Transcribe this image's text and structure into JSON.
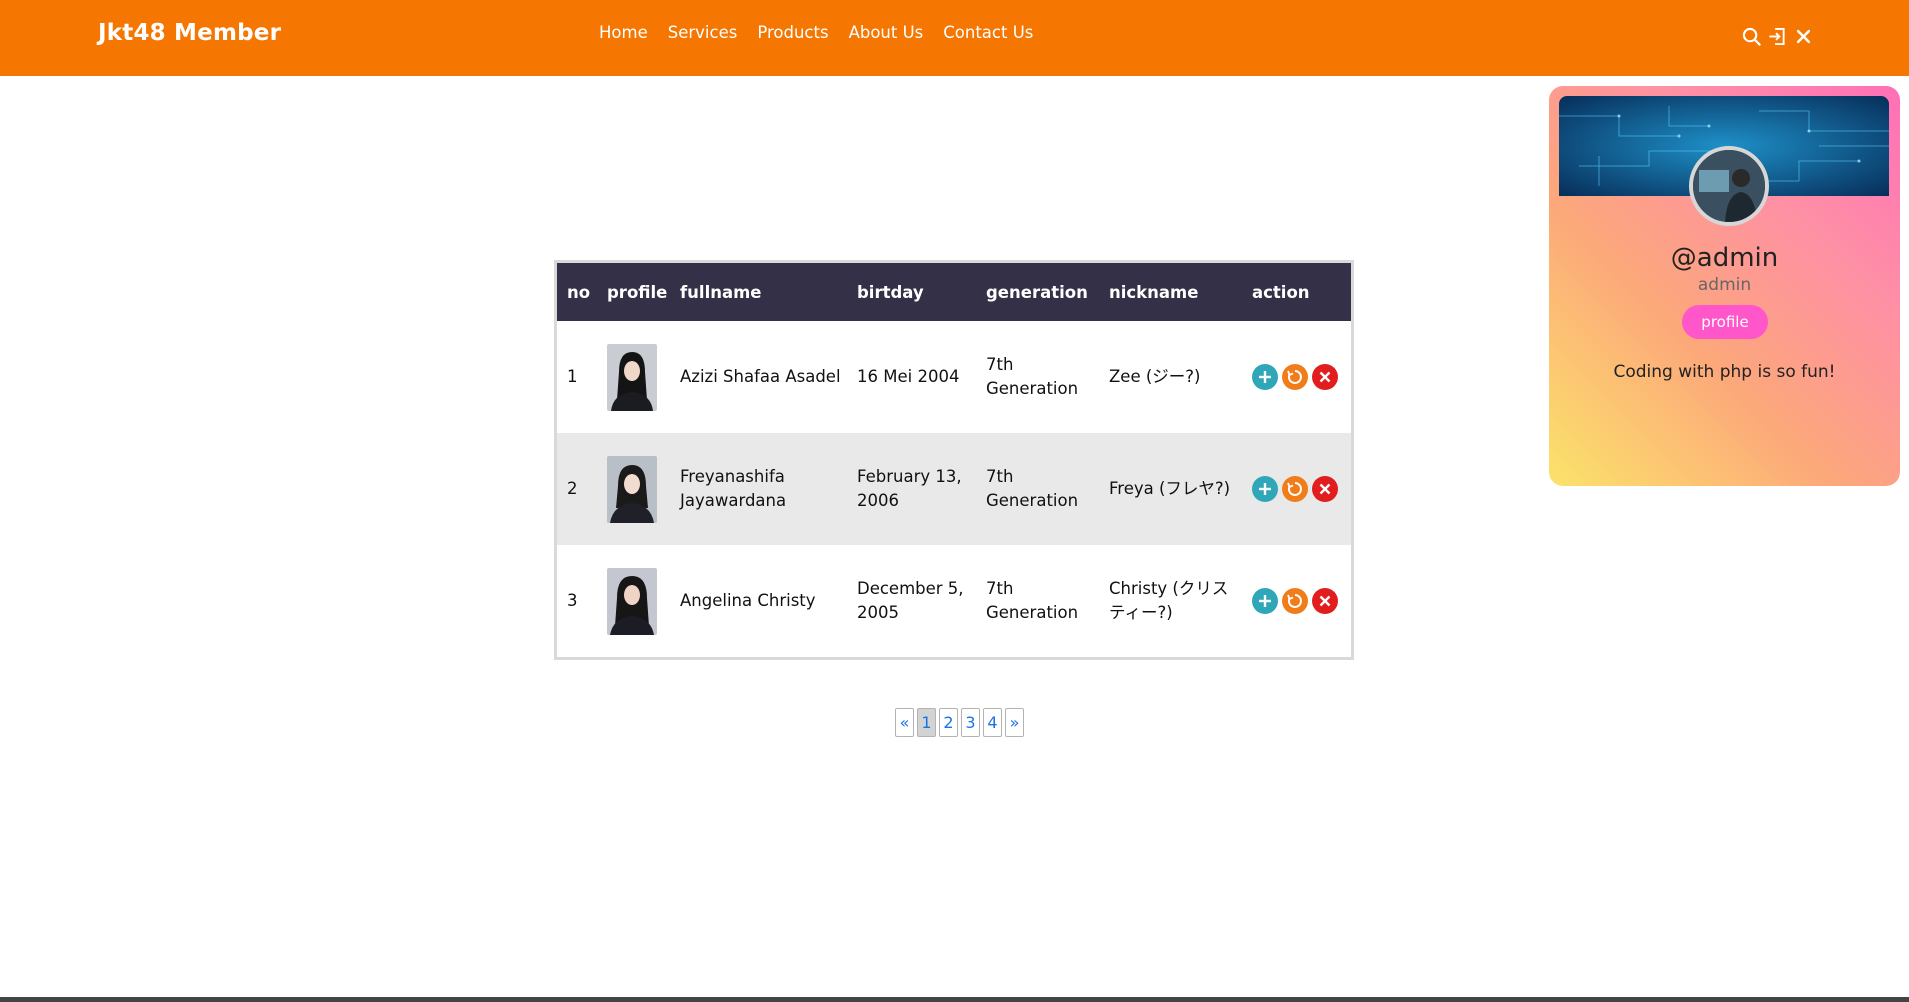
{
  "navbar": {
    "brand": "Jkt48 Member",
    "links": [
      "Home",
      "Services",
      "Products",
      "About Us",
      "Contact Us"
    ],
    "icons": [
      "search-icon",
      "login-icon",
      "close-icon"
    ],
    "color": "#f57702"
  },
  "table": {
    "headers": [
      "no",
      "profile",
      "fullname",
      "birtday",
      "generation",
      "nickname",
      "action"
    ],
    "rows": [
      {
        "no": "1",
        "fullname": "Azizi Shafaa Asadel",
        "birthday": "16 Mei 2004",
        "generation": "7th Generation",
        "nickname": "Zee (ジー?)"
      },
      {
        "no": "2",
        "fullname": "Freyanashifa Jayawardana",
        "birthday": "February 13, 2006",
        "generation": "7th Generation",
        "nickname": "Freya (フレヤ?)"
      },
      {
        "no": "3",
        "fullname": "Angelina Christy",
        "birthday": "December 5, 2005",
        "generation": "7th Generation",
        "nickname": "Christy (クリスティー?)"
      }
    ],
    "action_icons": [
      "add-icon",
      "edit-icon",
      "delete-icon"
    ],
    "header_color": "#333047"
  },
  "pagination": {
    "prev": "«",
    "pages": [
      "1",
      "2",
      "3",
      "4"
    ],
    "current": "1",
    "next": "»"
  },
  "profile_card": {
    "username": "@admin",
    "role": "admin",
    "button_label": "profile",
    "bio": "Coding with php is so fun!"
  }
}
